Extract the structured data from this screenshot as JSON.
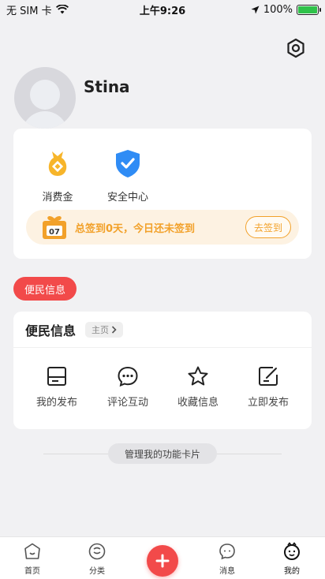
{
  "status_bar": {
    "carrier": "无 SIM 卡",
    "time": "上午9:26",
    "battery": "100%"
  },
  "profile": {
    "username": "Stina"
  },
  "quick_actions": [
    {
      "label": "消费金",
      "icon": "money-bag-icon"
    },
    {
      "label": "安全中心",
      "icon": "shield-check-icon"
    }
  ],
  "checkin": {
    "text": "总签到0天，今日还未签到",
    "button_label": "去签到",
    "calendar_text": "07"
  },
  "section_chip": "便民信息",
  "info_card": {
    "title": "便民信息",
    "home_chip": "主页",
    "items": [
      {
        "label": "我的发布",
        "icon": "document-icon"
      },
      {
        "label": "评论互动",
        "icon": "comment-icon"
      },
      {
        "label": "收藏信息",
        "icon": "star-icon"
      },
      {
        "label": "立即发布",
        "icon": "edit-icon"
      }
    ]
  },
  "manage_button": "管理我的功能卡片",
  "tabbar": {
    "tabs": [
      {
        "label": "首页",
        "icon": "home-icon"
      },
      {
        "label": "分类",
        "icon": "category-icon"
      },
      {
        "label": "",
        "icon": "plus-icon"
      },
      {
        "label": "消息",
        "icon": "message-icon"
      },
      {
        "label": "我的",
        "icon": "profile-icon"
      }
    ]
  },
  "colors": {
    "accent_red": "#f24a4a",
    "checkin_orange": "#f2a12a",
    "shield_blue": "#2f8cf5",
    "money_gold": "#f7b52a"
  }
}
